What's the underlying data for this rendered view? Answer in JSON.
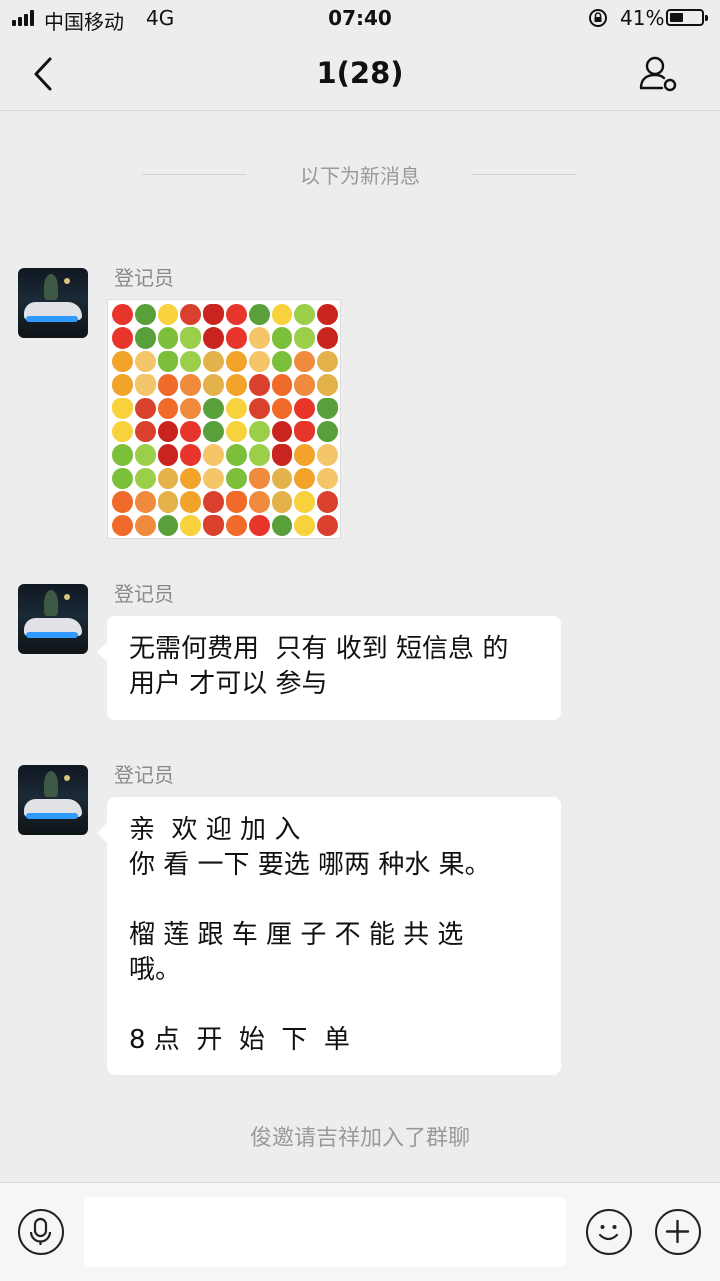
{
  "status_bar": {
    "carrier": "中国移动",
    "network": "4G",
    "time": "07:40",
    "battery_percent": "41%",
    "battery_level": 0.41
  },
  "nav": {
    "title": "1(28)",
    "back_icon": "chevron-left-icon",
    "profile_icon": "person-icon"
  },
  "divider_text": "以下为新消息",
  "messages": [
    {
      "sender": "登记员",
      "type": "image",
      "image": "fruit-collage"
    },
    {
      "sender": "登记员",
      "type": "text",
      "lines": [
        "无需何费用  只有 收到 短信息 的",
        "用户 才可以 参与"
      ]
    },
    {
      "sender": "登记员",
      "type": "text",
      "lines": [
        "亲  欢 迎 加 入",
        "你 看 一下 要选 哪两 种水 果。",
        "",
        "榴 莲 跟 车 厘 子 不 能 共 选",
        "哦。",
        "",
        "8 点  开  始  下  单"
      ]
    }
  ],
  "system_notice": "俊邀请吉祥加入了群聊",
  "input_bar": {
    "voice_icon": "microphone-icon",
    "emoji_icon": "smiley-icon",
    "add_icon": "plus-icon",
    "text_value": ""
  }
}
